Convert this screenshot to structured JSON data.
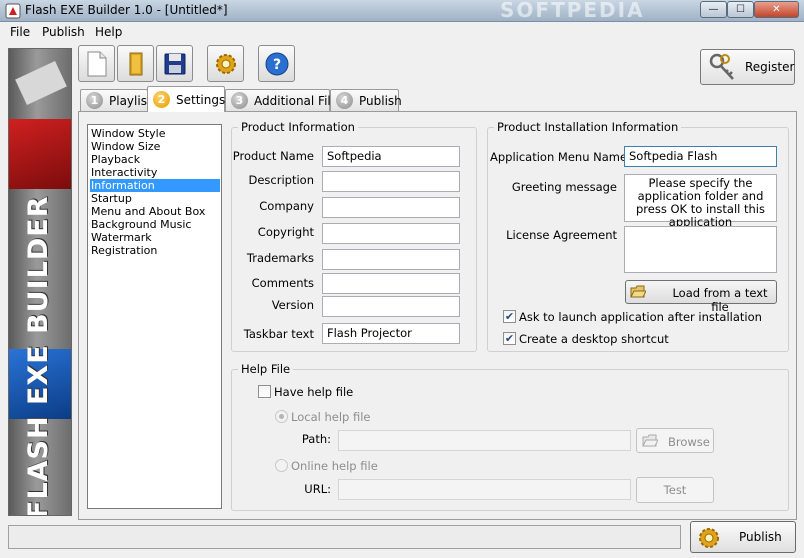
{
  "window": {
    "title": "Flash EXE Builder 1.0 - [Untitled*]",
    "watermark": "SOFTPEDIA",
    "controls": {
      "minimize": "—",
      "maximize": "☐",
      "close": "✕"
    }
  },
  "menu": [
    "File",
    "Publish",
    "Help"
  ],
  "banner": {
    "text": "FLASH EXE BUILDER"
  },
  "toolbar": {
    "buttons": [
      "new-document-icon",
      "open-folder-icon",
      "save-disk-icon",
      "settings-gear-icon",
      "help-question-icon"
    ],
    "register_label": "Register"
  },
  "tabs": [
    {
      "num": "1",
      "label": "Playlist",
      "active": false
    },
    {
      "num": "2",
      "label": "Settings",
      "active": true
    },
    {
      "num": "3",
      "label": "Additional Files",
      "active": false
    },
    {
      "num": "4",
      "label": "Publish",
      "active": false
    }
  ],
  "settings_list": {
    "items": [
      "Window Style",
      "Window Size",
      "Playback",
      "Interactivity",
      "Information",
      "Startup",
      "Menu and About Box",
      "Background Music",
      "Watermark",
      "Registration"
    ],
    "selected": "Information"
  },
  "product_info": {
    "title": "Product Information",
    "fields": [
      {
        "label": "Product Name",
        "value": "Softpedia"
      },
      {
        "label": "Description",
        "value": ""
      },
      {
        "label": "Company",
        "value": ""
      },
      {
        "label": "Copyright",
        "value": ""
      },
      {
        "label": "Trademarks",
        "value": ""
      },
      {
        "label": "Comments",
        "value": ""
      },
      {
        "label": "Version",
        "value": ""
      },
      {
        "label": "Taskbar text",
        "value": "Flash Projector"
      }
    ]
  },
  "install_info": {
    "title": "Product Installation Information",
    "app_menu_label": "Application Menu Name",
    "app_menu_value": "Softpedia Flash",
    "greeting_label": "Greeting message",
    "greeting_value": "Please specify the application folder and press OK to install this application",
    "license_label": "License Agreement",
    "license_value": "",
    "load_button": "Load from a text file",
    "ask_launch_label": "Ask to launch application after installation",
    "ask_launch_checked": true,
    "desktop_shortcut_label": "Create a desktop shortcut",
    "desktop_shortcut_checked": true
  },
  "help_file": {
    "title": "Help File",
    "have_help_label": "Have help file",
    "have_help_checked": false,
    "local_label": "Local help file",
    "path_label": "Path:",
    "path_value": "",
    "browse_label": "Browse",
    "online_label": "Online help file",
    "url_label": "URL:",
    "url_value": "",
    "test_label": "Test"
  },
  "footer": {
    "publish_label": "Publish",
    "status_text": ""
  },
  "colors": {
    "selection": "#3399ff",
    "accent_orange": "#e79a00",
    "banner_red": "#d02020",
    "banner_blue": "#2a73d6"
  }
}
